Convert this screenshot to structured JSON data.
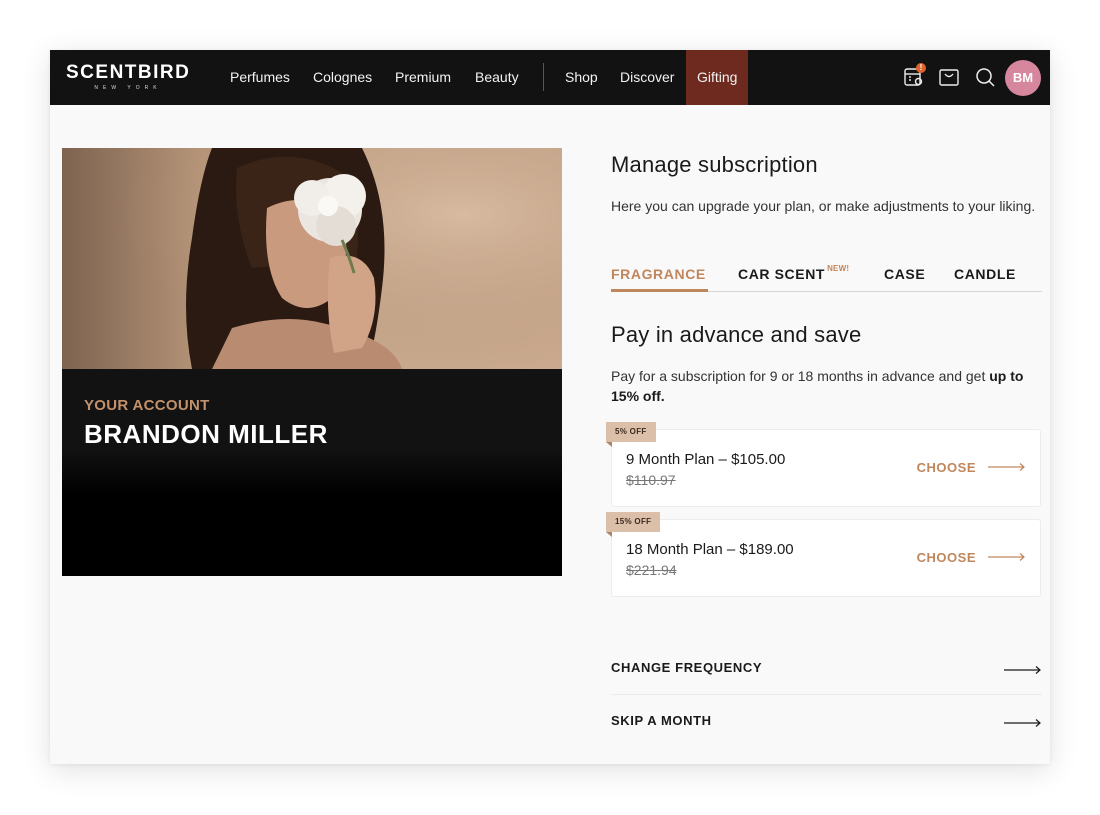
{
  "brand": {
    "name": "SCENTBIRD",
    "tagline": "NEW YORK"
  },
  "nav": {
    "links": [
      "Perfumes",
      "Colognes",
      "Premium",
      "Beauty",
      "Shop",
      "Discover",
      "Gifting"
    ],
    "notification_badge": "!",
    "avatar_initials": "BM"
  },
  "account": {
    "label": "YOUR ACCOUNT",
    "name": "BRANDON MILLER"
  },
  "manage": {
    "title": "Manage subscription",
    "subtitle": "Here you can upgrade your plan, or make adjustments to your liking.",
    "tabs": [
      {
        "label": "FRAGRANCE",
        "active": true
      },
      {
        "label": "CAR SCENT",
        "sup": "NEW!"
      },
      {
        "label": "CASE"
      },
      {
        "label": "CANDLE"
      }
    ]
  },
  "advance": {
    "title": "Pay in advance and save",
    "desc_plain": "Pay for a subscription for 9 or 18 months in advance and get ",
    "desc_bold": "up to 15% off.",
    "plans": [
      {
        "tag": "5% OFF",
        "name": "9 Month Plan – $105.00",
        "old_price": "$110.97",
        "cta": "CHOOSE"
      },
      {
        "tag": "15% OFF",
        "name": "18 Month Plan – $189.00",
        "old_price": "$221.94",
        "cta": "CHOOSE"
      }
    ]
  },
  "actions": {
    "change_frequency": "CHANGE FREQUENCY",
    "skip_month": "SKIP A MONTH"
  },
  "colors": {
    "accent": "#c0865c",
    "nav_bg": "#121212",
    "gifting_bg": "#6e2a1f",
    "avatar_bg": "#d6879d",
    "tag_bg": "#dcbfa8"
  },
  "icons": [
    "calendar-alert-icon",
    "cart-icon",
    "search-icon",
    "arrow-right-icon"
  ]
}
